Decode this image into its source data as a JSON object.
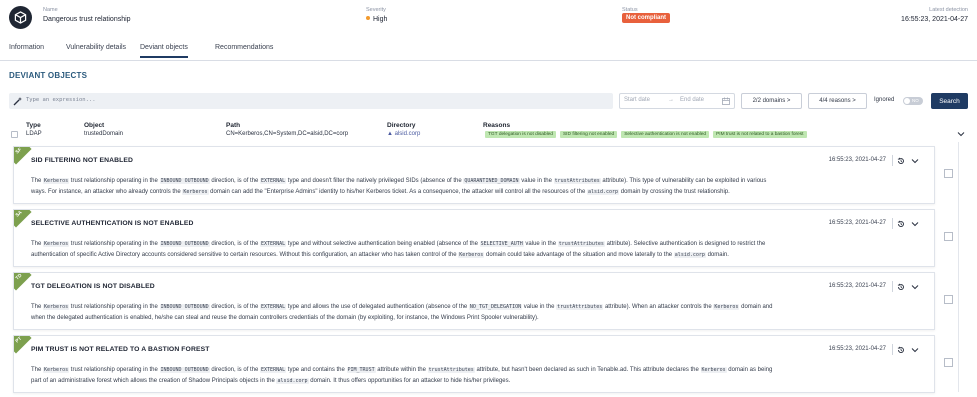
{
  "header": {
    "name_label": "Name",
    "name_value": "Dangerous trust relationship",
    "severity_label": "Severity",
    "severity_value": "High",
    "status_label": "Status",
    "status_value": "Not compliant",
    "detection_label": "Latest detection",
    "detection_value": "16:55:23, 2021-04-27"
  },
  "tabs": [
    "Information",
    "Vulnerability details",
    "Deviant objects",
    "Recommendations"
  ],
  "section_title": "DEVIANT OBJECTS",
  "filters": {
    "search_placeholder": "Type an expression...",
    "start_date": "Start date",
    "arrow": "→",
    "end_date": "End date",
    "domains_button": "2/2 domains >",
    "reasons_button": "4/4 reasons >",
    "ignored_label": "Ignored",
    "toggle_label": "NO",
    "search_button": "Search"
  },
  "table": {
    "columns": [
      "Type",
      "Object",
      "Path",
      "Directory",
      "Reasons"
    ],
    "row": {
      "type": "LDAP",
      "object": "trustedDomain",
      "path": "CN=Kerberos,CN=System,DC=alsid,DC=corp",
      "directory": "▲ alsid.corp",
      "reasons": [
        "TGT delegation is not disabled",
        "SID filtering not enabled",
        "Selective authentication is not enabled",
        "PIM trust is not related to a bastion forest"
      ]
    }
  },
  "cards": [
    {
      "code": "SF",
      "title": "SID FILTERING NOT ENABLED",
      "time": "16:55:23, 2021-04-27",
      "line1": [
        "The ",
        "Kerberos",
        " trust relationship operating in the ",
        "INBOUND OUTBOUND",
        " direction, is of the ",
        "EXTERNAL",
        " type and doesn't filter the natively privileged SIDs (absence of the ",
        "QUARANTINED_DOMAIN",
        " value in the ",
        "trustAttributes",
        " attribute). This type of vulnerability can be exploited in various"
      ],
      "line2": [
        "ways. For instance, an attacker who already controls the ",
        "Kerberos",
        " domain can add the \"Enterprise Admins\" identity to his/her Kerberos ticket. As a consequence, the attacker will control all the resources of the ",
        "alsid.corp",
        " domain by crossing the trust relationship."
      ]
    },
    {
      "code": "SA",
      "title": "SELECTIVE AUTHENTICATION IS NOT ENABLED",
      "time": "16:55:23, 2021-04-27",
      "line1": [
        "The ",
        "Kerberos",
        " trust relationship operating in the ",
        "INBOUND OUTBOUND",
        " direction, is of the ",
        "EXTERNAL",
        " type and without selective authentication being enabled (absence of the ",
        "SELECTIVE_AUTH",
        " value in the ",
        "trustAttributes",
        " attribute). Selective authentication is designed to restrict the"
      ],
      "line2": [
        "authentication of specific Active Directory accounts considered sensitive to certain resources. Without this configuration, an attacker who has taken control of the ",
        "Kerberos",
        " domain could take advantage of the situation and move laterally to the ",
        "alsid.corp",
        " domain."
      ]
    },
    {
      "code": "TD",
      "title": "TGT DELEGATION IS NOT DISABLED",
      "time": "16:55:23, 2021-04-27",
      "line1": [
        "The ",
        "Kerberos",
        " trust relationship operating in the ",
        "INBOUND OUTBOUND",
        " direction, is of the ",
        "EXTERNAL",
        " type and allows the use of delegated authentication (absence of the ",
        "NO_TGT_DELEGATION",
        " value in the ",
        "trustAttributes",
        " attribute). When an attacker controls the ",
        "Kerberos",
        " domain and"
      ],
      "line2": [
        "when the delegated authentication is enabled, he/she can steal and reuse the domain controllers credentials of the domain (by exploiting, for instance, the Windows Print Spooler vulnerability)."
      ]
    },
    {
      "code": "PT",
      "title": "PIM TRUST IS NOT RELATED TO A BASTION FOREST",
      "time": "16:55:23, 2021-04-27",
      "line1": [
        "The ",
        "Kerberos",
        " trust relationship operating in the ",
        "INBOUND OUTBOUND",
        " direction, is of the ",
        "EXTERNAL",
        " type and contains the ",
        "PIM_TRUST",
        " attribute within the ",
        "trustAttributes",
        " attribute, but hasn't been declared as such in Tenable.ad. This attribute declares the ",
        "Kerberos",
        " domain as being"
      ],
      "line2": [
        "part of an administrative forest which allows the creation of Shadow Principals objects in the ",
        "alsid.corp",
        " domain. It thus offers opportunities for an attacker to hide his/her privileges."
      ]
    }
  ],
  "colors": {
    "accent": "#1f3b63",
    "status_red": "#e8603c",
    "severity_orange": "#f29a2e",
    "reason_green": "#bfe7b1",
    "card_tab": "#7da04e"
  }
}
